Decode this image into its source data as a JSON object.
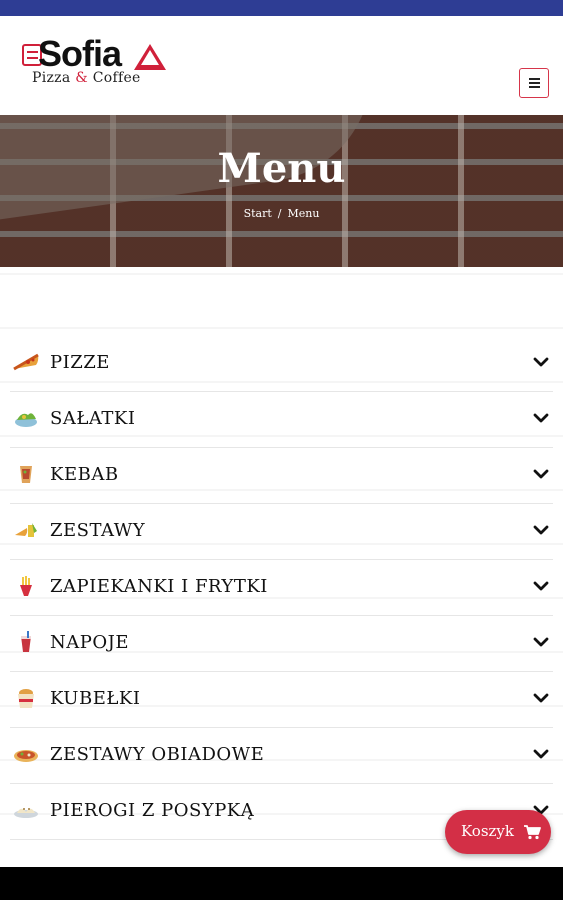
{
  "brand": {
    "name": "Sofia",
    "subtitle_part1": "Pizza ",
    "subtitle_amp": "&",
    "subtitle_part2": " Coffee"
  },
  "header": {
    "menu_button": "menu-icon"
  },
  "hero": {
    "title": "Menu",
    "breadcrumb": [
      "Start",
      "/",
      "Menu"
    ]
  },
  "menu": {
    "items": [
      {
        "label": "PIZZE",
        "icon": "pizza-slice-icon"
      },
      {
        "label": "SAŁATKI",
        "icon": "salad-icon"
      },
      {
        "label": "KEBAB",
        "icon": "kebab-icon"
      },
      {
        "label": "ZESTAWY",
        "icon": "combo-icon"
      },
      {
        "label": "ZAPIEKANKI I FRYTKI",
        "icon": "fries-icon"
      },
      {
        "label": "NAPOJE",
        "icon": "drink-icon"
      },
      {
        "label": "KUBEŁKI",
        "icon": "bucket-icon"
      },
      {
        "label": "ZESTAWY OBIADOWE",
        "icon": "dinner-icon"
      },
      {
        "label": "PIEROGI Z POSYPKĄ",
        "icon": "dumplings-icon"
      }
    ]
  },
  "cart": {
    "label": "Koszyk",
    "icon": "cart-icon"
  },
  "colors": {
    "topbar": "#2e3d94",
    "accent": "#d32f46"
  }
}
